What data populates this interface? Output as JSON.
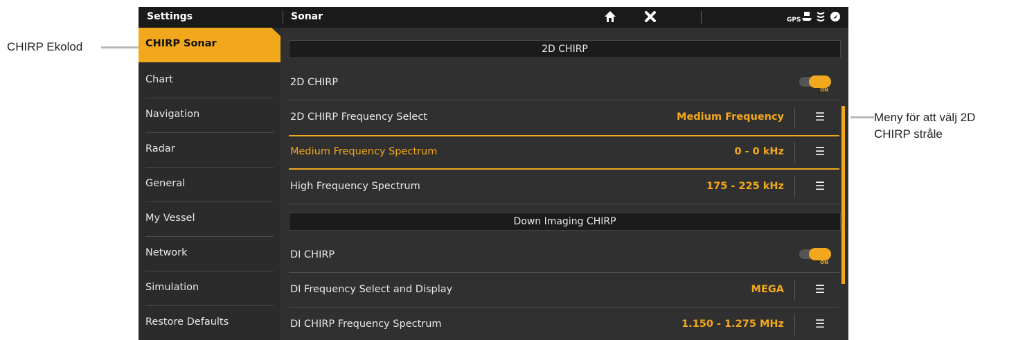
{
  "callouts": {
    "left": "CHIRP Ekolod",
    "right_line1": "Meny för att välj 2D",
    "right_line2": "CHIRP stråle"
  },
  "topbar": {
    "left_title": "Settings",
    "mid_title": "Sonar",
    "home_icon": "home-icon",
    "close_icon": "close-icon",
    "status_icons": [
      "gps-icon",
      "boat-icon",
      "sonar-icon",
      "compass-icon"
    ]
  },
  "sidebar": {
    "items": [
      {
        "label": "CHIRP Sonar",
        "active": true
      },
      {
        "label": "Chart"
      },
      {
        "label": "Navigation"
      },
      {
        "label": "Radar"
      },
      {
        "label": "General"
      },
      {
        "label": "My Vessel"
      },
      {
        "label": "Network"
      },
      {
        "label": "Simulation"
      },
      {
        "label": "Restore Defaults"
      }
    ]
  },
  "main": {
    "section1": "2D CHIRP",
    "row1": {
      "label": "2D CHIRP",
      "toggle": "ON"
    },
    "row2": {
      "label": "2D CHIRP Frequency Select",
      "value": "Medium Frequency"
    },
    "row3": {
      "label": "Medium Frequency Spectrum",
      "value": "0 - 0 kHz"
    },
    "row4": {
      "label": "High Frequency Spectrum",
      "value": "175 - 225 kHz"
    },
    "section2": "Down Imaging CHIRP",
    "row5": {
      "label": "DI CHIRP",
      "toggle": "ON"
    },
    "row6": {
      "label": "DI Frequency Select and Display",
      "value": "MEGA"
    },
    "row7": {
      "label": "DI CHIRP Frequency Spectrum",
      "value": "1.150 - 1.275 MHz"
    }
  },
  "colors": {
    "accent": "#f2a81d",
    "panel": "#303030",
    "topbar": "#1a1a1a"
  }
}
